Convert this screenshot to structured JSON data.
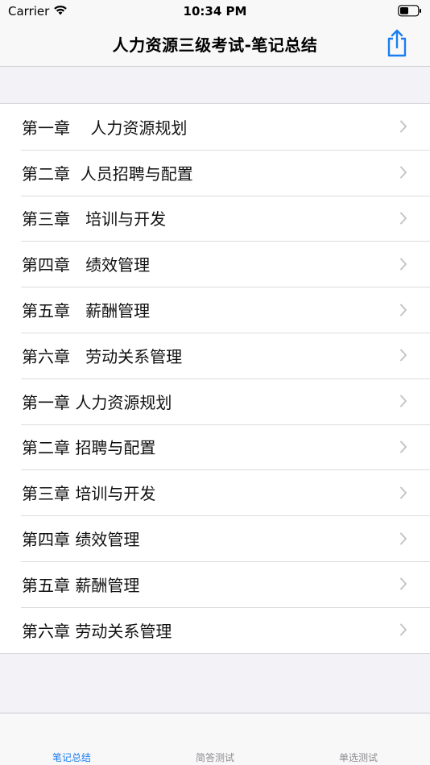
{
  "status_bar": {
    "carrier": "Carrier",
    "time": "10:34 PM",
    "icons": [
      "wifi-icon",
      "battery-icon"
    ]
  },
  "nav": {
    "title": "人力资源三级考试-笔记总结",
    "share_icon": "share-icon"
  },
  "colors": {
    "accent": "#1a7ef2",
    "background": "#f2f2f7",
    "chevron": "#c4c4c7"
  },
  "list": {
    "items": [
      {
        "label": "第一章    人力资源规划"
      },
      {
        "label": "第二章  人员招聘与配置"
      },
      {
        "label": "第三章   培训与开发"
      },
      {
        "label": "第四章   绩效管理"
      },
      {
        "label": "第五章   薪酬管理"
      },
      {
        "label": "第六章   劳动关系管理"
      },
      {
        "label": "第一章 人力资源规划"
      },
      {
        "label": "第二章 招聘与配置"
      },
      {
        "label": "第三章 培训与开发"
      },
      {
        "label": "第四章 绩效管理"
      },
      {
        "label": "第五章 薪酬管理"
      },
      {
        "label": "第六章 劳动关系管理"
      }
    ]
  },
  "tabs": [
    {
      "label": "笔记总结",
      "active": true
    },
    {
      "label": "简答测试",
      "active": false
    },
    {
      "label": "单选测试",
      "active": false
    }
  ]
}
